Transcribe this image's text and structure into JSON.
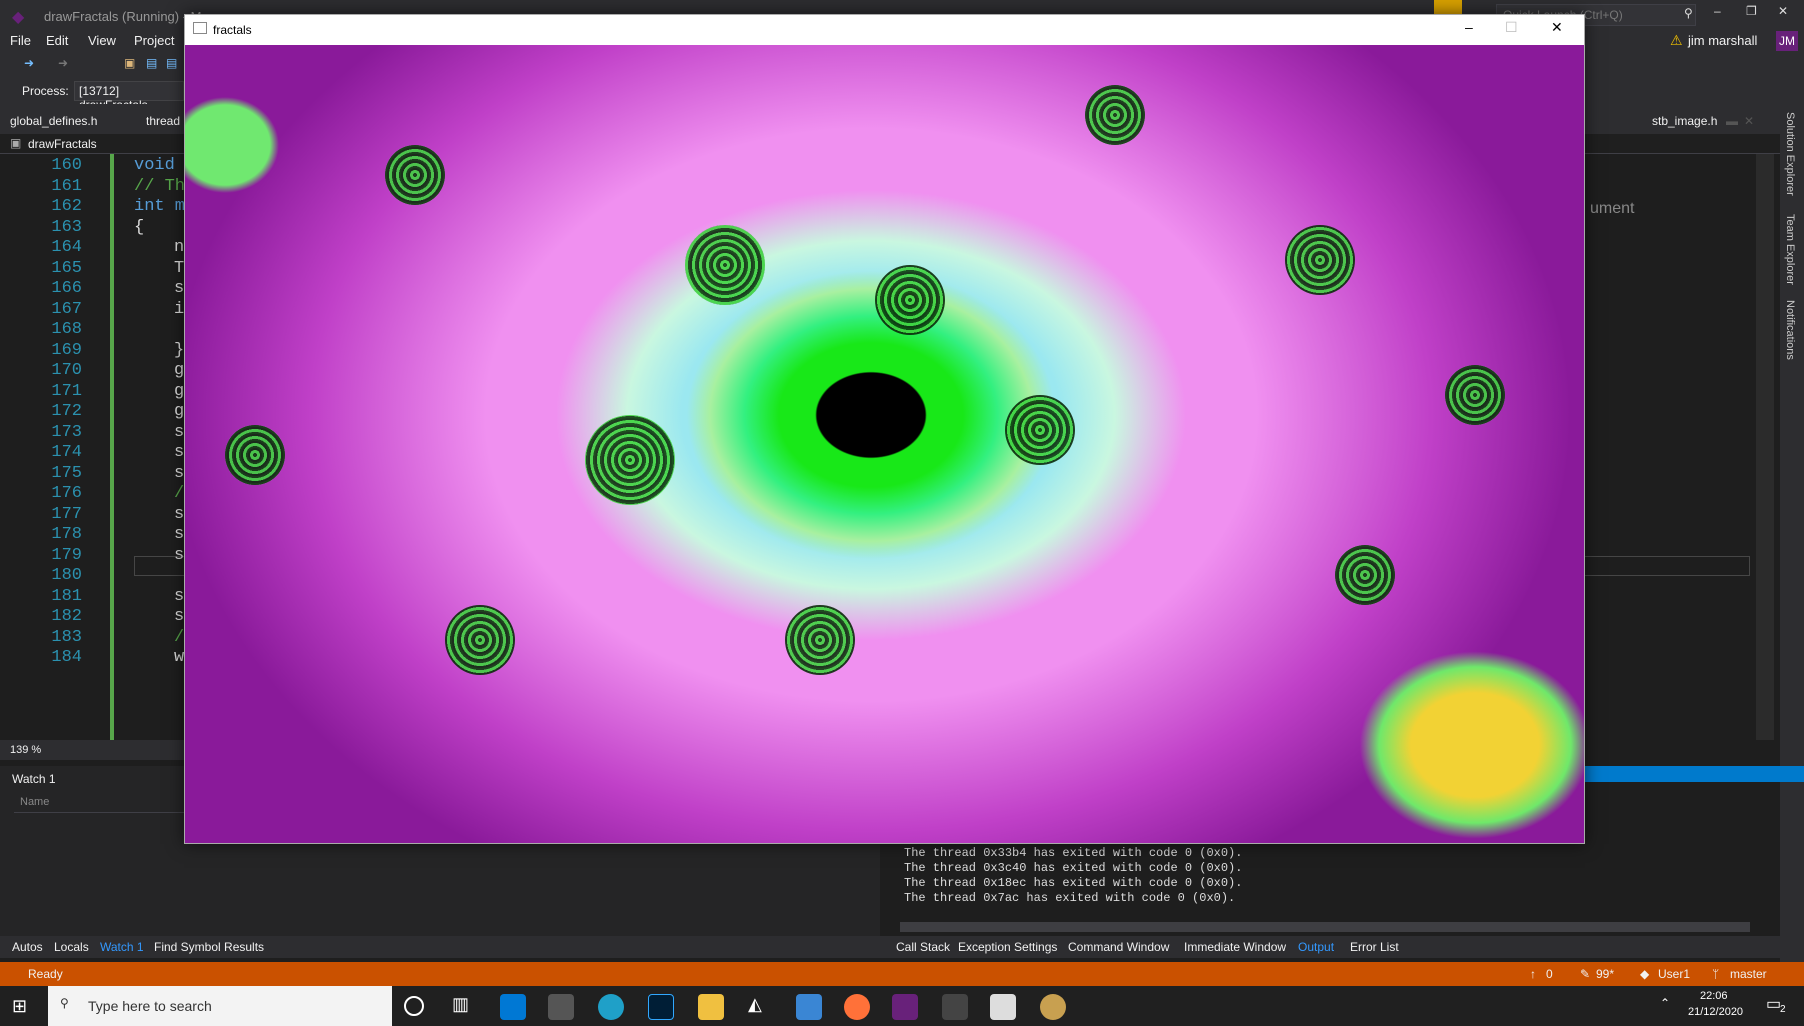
{
  "ide": {
    "title": "drawFractals (Running) - M",
    "quick_launch": "Quick Launch (Ctrl+Q)",
    "user": "jim marshall",
    "user_initials": "JM",
    "menu": [
      "File",
      "Edit",
      "View",
      "Project"
    ],
    "process_label": "Process:",
    "process_value": "[13712] drawFractals",
    "tabs": [
      "global_defines.h",
      "thread"
    ],
    "right_tab": "stb_image.h",
    "nav_file": "drawFractals",
    "right_panel_text": "ument",
    "side_tabs": [
      "Solution Explorer",
      "Team Explorer",
      "Notifications"
    ],
    "zoom": "139 %",
    "line_numbers": [
      "160",
      "161",
      "162",
      "163",
      "164",
      "165",
      "166",
      "167",
      "168",
      "169",
      "170",
      "171",
      "172",
      "173",
      "174",
      "175",
      "176",
      "177",
      "178",
      "179",
      "180",
      "181",
      "182",
      "183",
      "184"
    ],
    "code_lines": [
      "void",
      "// Th",
      "int m",
      "{",
      "n",
      "T",
      "s",
      "i",
      "",
      "}",
      "g",
      "g",
      "g",
      "s",
      "s",
      "s",
      "/",
      "s",
      "s",
      "s",
      "",
      "s",
      "s",
      "/",
      "w"
    ],
    "watch": {
      "title": "Watch 1",
      "col_name": "Name"
    },
    "output_lines": [
      "The thread 0x33b4 has exited with code 0 (0x0).",
      "The thread 0x3c40 has exited with code 0 (0x0).",
      "The thread 0x18ec has exited with code 0 (0x0).",
      "The thread 0x7ac has exited with code 0 (0x0)."
    ],
    "bottom_tabs_left": [
      "Autos",
      "Locals",
      "Watch 1",
      "Find Symbol Results"
    ],
    "bottom_tabs_right": [
      "Call Stack",
      "Exception Settings",
      "Command Window",
      "Immediate Window",
      "Output",
      "Error List"
    ],
    "status": {
      "ready": "Ready",
      "up": "0",
      "pen": "99*",
      "user": "User1",
      "branch": "master"
    }
  },
  "fractal_window": {
    "title": "fractals"
  },
  "taskbar": {
    "search_placeholder": "Type here to search",
    "time": "22:06",
    "date": "21/12/2020",
    "notif_count": "2"
  },
  "colors": {
    "status_bar": "#ca5100",
    "accent": "#007acc",
    "line_number": "#2b91af",
    "vs_purple": "#68217a"
  }
}
